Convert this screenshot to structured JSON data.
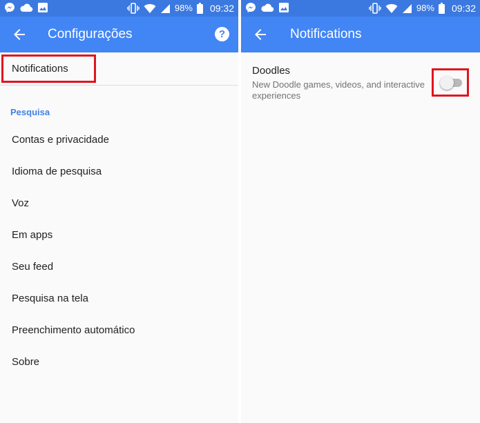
{
  "colors": {
    "status_bar": "#3b79e0",
    "app_bar": "#4285f4",
    "section_header": "#3f82e8",
    "highlight_box": "#e0141e",
    "background": "#fafafa"
  },
  "status_bar": {
    "left_icons": [
      "messenger-icon",
      "cloud-icon",
      "image-icon"
    ],
    "right_icons": [
      "vibrate-icon",
      "wifi-icon",
      "signal-icon",
      "battery-icon"
    ],
    "battery": "98%",
    "time": "09:32"
  },
  "left_screen": {
    "title": "Configurações",
    "back_icon": "arrow-back-icon",
    "help_icon": "help-icon",
    "help_glyph": "?",
    "top_item": "Notifications",
    "section_header": "Pesquisa",
    "items": [
      "Contas e privacidade",
      "Idioma de pesquisa",
      "Voz",
      "Em apps",
      "Seu feed",
      "Pesquisa na tela",
      "Preenchimento automático",
      "Sobre"
    ]
  },
  "right_screen": {
    "title": "Notifications",
    "back_icon": "arrow-back-icon",
    "pref": {
      "title": "Doodles",
      "summary": "New Doodle games, videos, and interactive experiences",
      "enabled": false
    }
  }
}
